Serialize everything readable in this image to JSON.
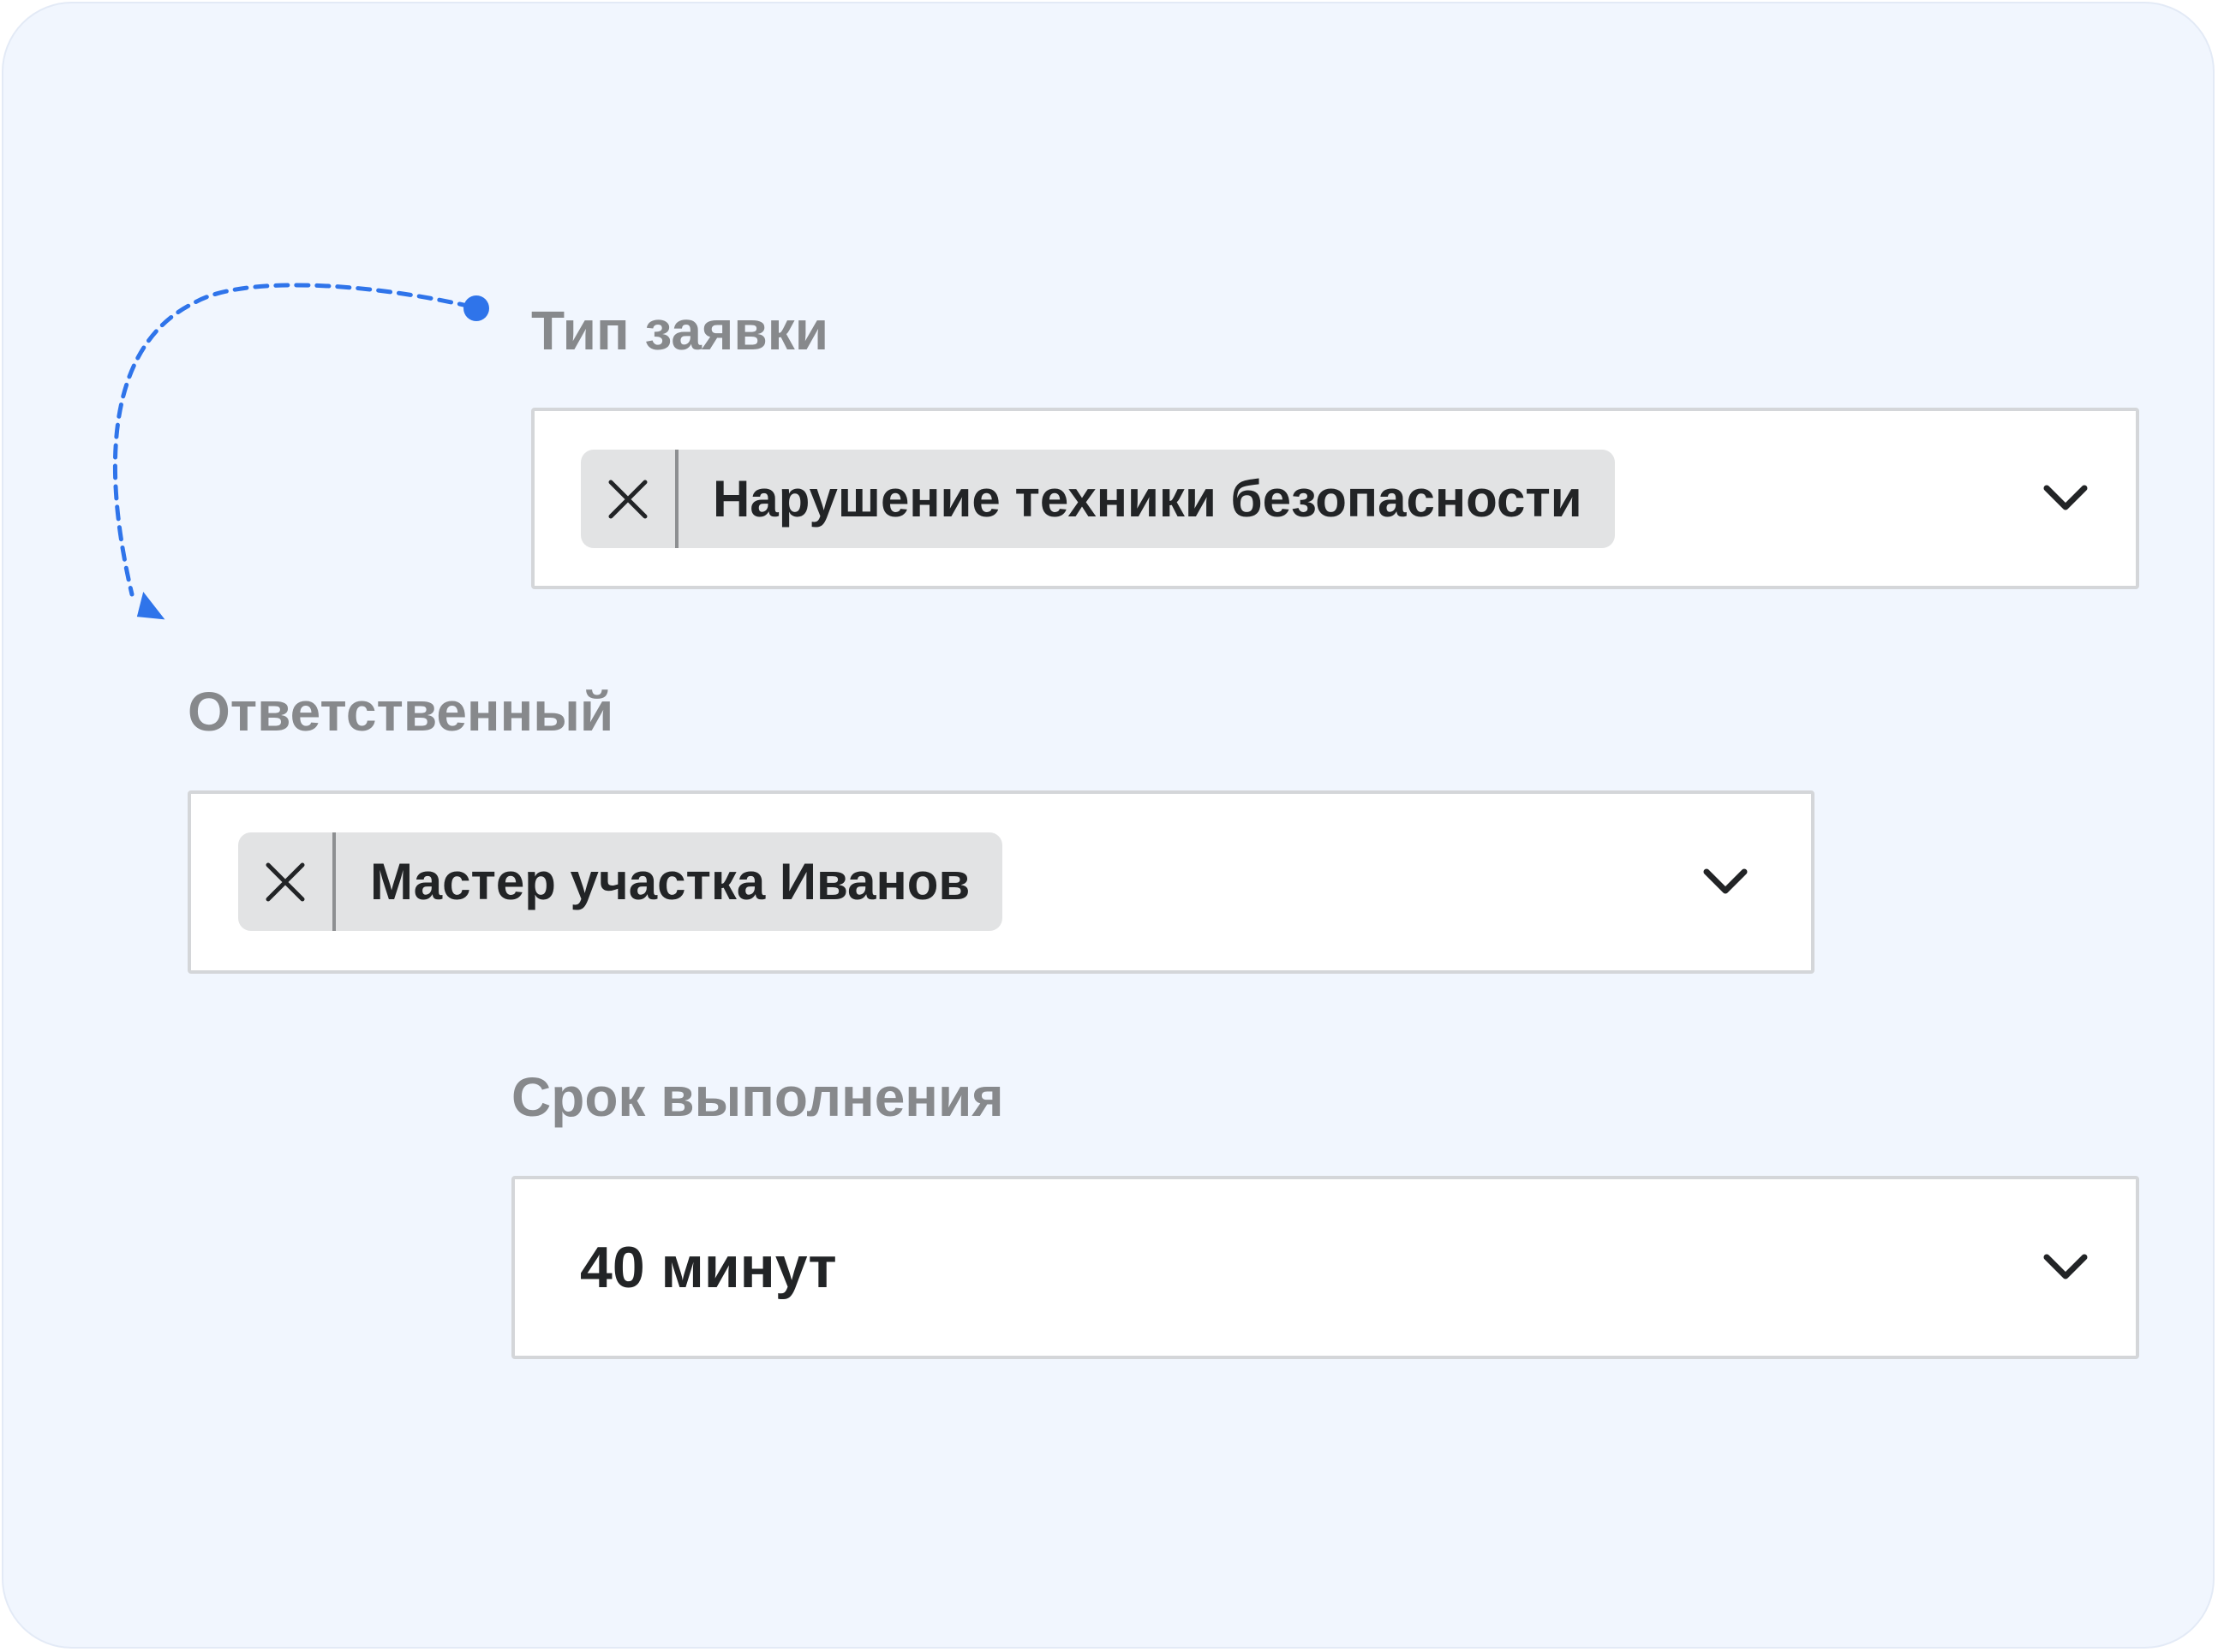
{
  "fields": {
    "request_type": {
      "label": "Тип заявки",
      "chip": "Нарушение техники безопасности"
    },
    "responsible": {
      "label": "Ответственный",
      "chip": "Мастер участка Иванов"
    },
    "deadline": {
      "label": "Срок выполнения",
      "value": "40 минут"
    }
  },
  "icons": {
    "remove": "close-icon",
    "dropdown": "chevron-down-icon"
  },
  "colors": {
    "background": "#f1f6fe",
    "accent": "#2f74ea",
    "chip": "#e2e3e4",
    "label": "#87898c",
    "text": "#222426"
  }
}
